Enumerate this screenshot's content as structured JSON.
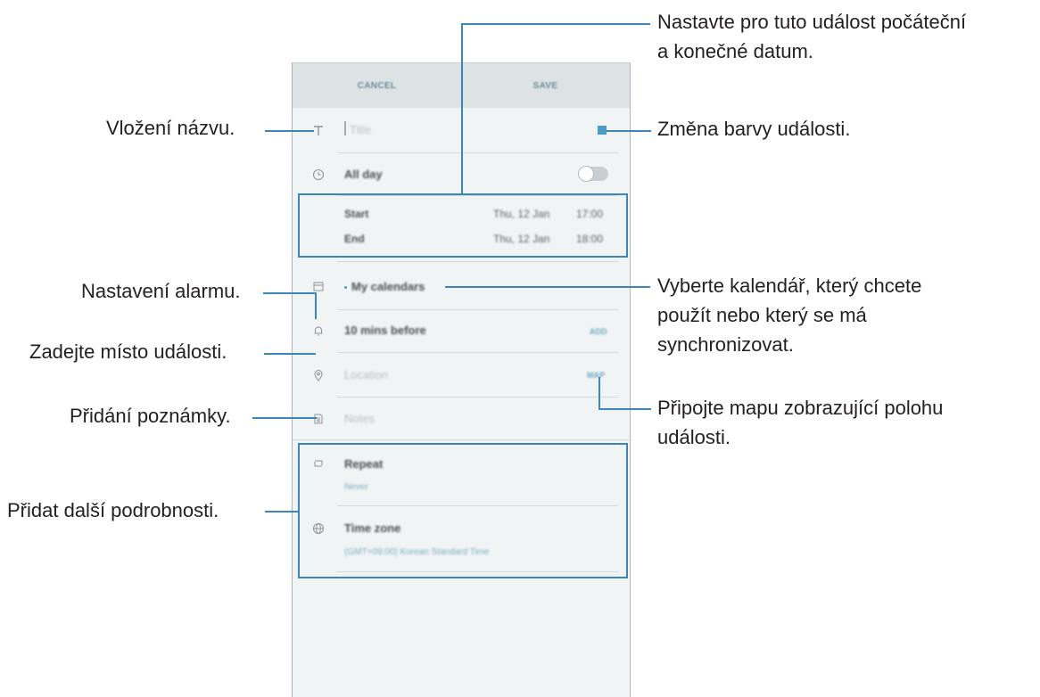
{
  "screen": {
    "cancel_label": "CANCEL",
    "save_label": "SAVE",
    "title_placeholder": "Title",
    "all_day_label": "All day",
    "start_label": "Start",
    "start_date": "Thu, 12 Jan",
    "start_time": "17:00",
    "end_label": "End",
    "end_date": "Thu, 12 Jan",
    "end_time": "18:00",
    "calendar_label": "My calendars",
    "reminder_label": "10 mins before",
    "reminder_action": "ADD",
    "location_placeholder": "Location",
    "location_action": "MAP",
    "notes_placeholder": "Notes",
    "repeat_label": "Repeat",
    "repeat_value": "Never",
    "timezone_label": "Time zone",
    "timezone_value": "(GMT+09:00) Korean Standard Time",
    "event_color": "#4a9cc6",
    "all_day_on": false
  },
  "callouts": {
    "title": "Vložení názvu.",
    "dates_line1": "Nastavte pro tuto událost počáteční",
    "dates_line2": "a konečné datum.",
    "color": "Změna barvy události.",
    "calendar_line1": "Vyberte kalendář, který chcete",
    "calendar_line2": "použít nebo který se má",
    "calendar_line3": "synchronizovat.",
    "alarm": "Nastavení alarmu.",
    "location": "Zadejte místo události.",
    "map_line1": "Připojte mapu zobrazující polohu",
    "map_line2": "události.",
    "notes": "Přidání poznámky.",
    "details": "Přidat další podrobnosti."
  },
  "icons": {
    "title": "text-icon",
    "all_day": "clock-icon",
    "calendar": "calendar-icon",
    "alarm": "bell-icon",
    "location": "location-pin-icon",
    "notes": "note-icon",
    "repeat": "repeat-icon",
    "timezone": "globe-icon"
  }
}
